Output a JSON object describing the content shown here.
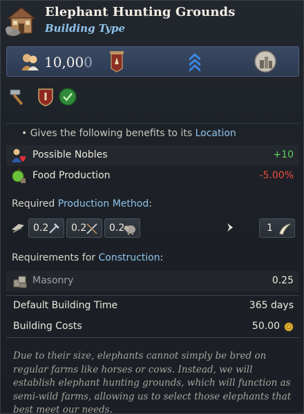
{
  "header": {
    "title": "Elephant Hunting Grounds",
    "subtitle": "Building Type",
    "icon": "building-house-icon"
  },
  "stats": {
    "population": "10,00",
    "population_fade": "0",
    "population_icon": "population-icon",
    "banner_icon": "banner-icon",
    "rank_icon": "rank-chevrons-icon",
    "city_icon": "city-icon"
  },
  "tags": [
    "hammer-icon",
    "shield-icon",
    "check-icon"
  ],
  "benefits": {
    "heading_prefix": "• Gives the following benefits to its ",
    "heading_link": "Location",
    "items": [
      {
        "label": "Possible Nobles",
        "value": "+10",
        "icon": "nobles-icon",
        "tone": "positive"
      },
      {
        "label": "Food Production",
        "value": "-5.00%",
        "icon": "food-icon",
        "tone": "negative"
      }
    ]
  },
  "production": {
    "label_prefix": "Required ",
    "label_link": "Production Method",
    "label_suffix": ":",
    "inputs": [
      {
        "amount": "0.2",
        "icon": "tools-icon"
      },
      {
        "amount": "0.2",
        "icon": "weapons-icon"
      },
      {
        "amount": "0.2",
        "icon": "livestock-icon"
      }
    ],
    "output": {
      "amount": "1",
      "icon": "ivory-icon"
    }
  },
  "requirements": {
    "label_prefix": "Requirements for ",
    "label_link": "Construction",
    "label_suffix": ":",
    "items": [
      {
        "label": "Masonry",
        "value": "0.25",
        "icon": "masonry-icon"
      }
    ]
  },
  "costs": {
    "build_time_label": "Default Building Time",
    "build_time_value": "365 days",
    "cost_label": "Building Costs",
    "cost_value": "50.00",
    "cost_icon": "gold-coin-icon"
  },
  "flavor": "Due to their size, elephants cannot simply be bred on regular farms like horses or cows. Instead, we will establish elephant hunting grounds, which will function as semi-wild farms, allowing us to select those elephants that best meet our needs.",
  "colors": {
    "accent": "#8fc4ec",
    "positive": "#5fcf63",
    "negative": "#f04a42"
  }
}
